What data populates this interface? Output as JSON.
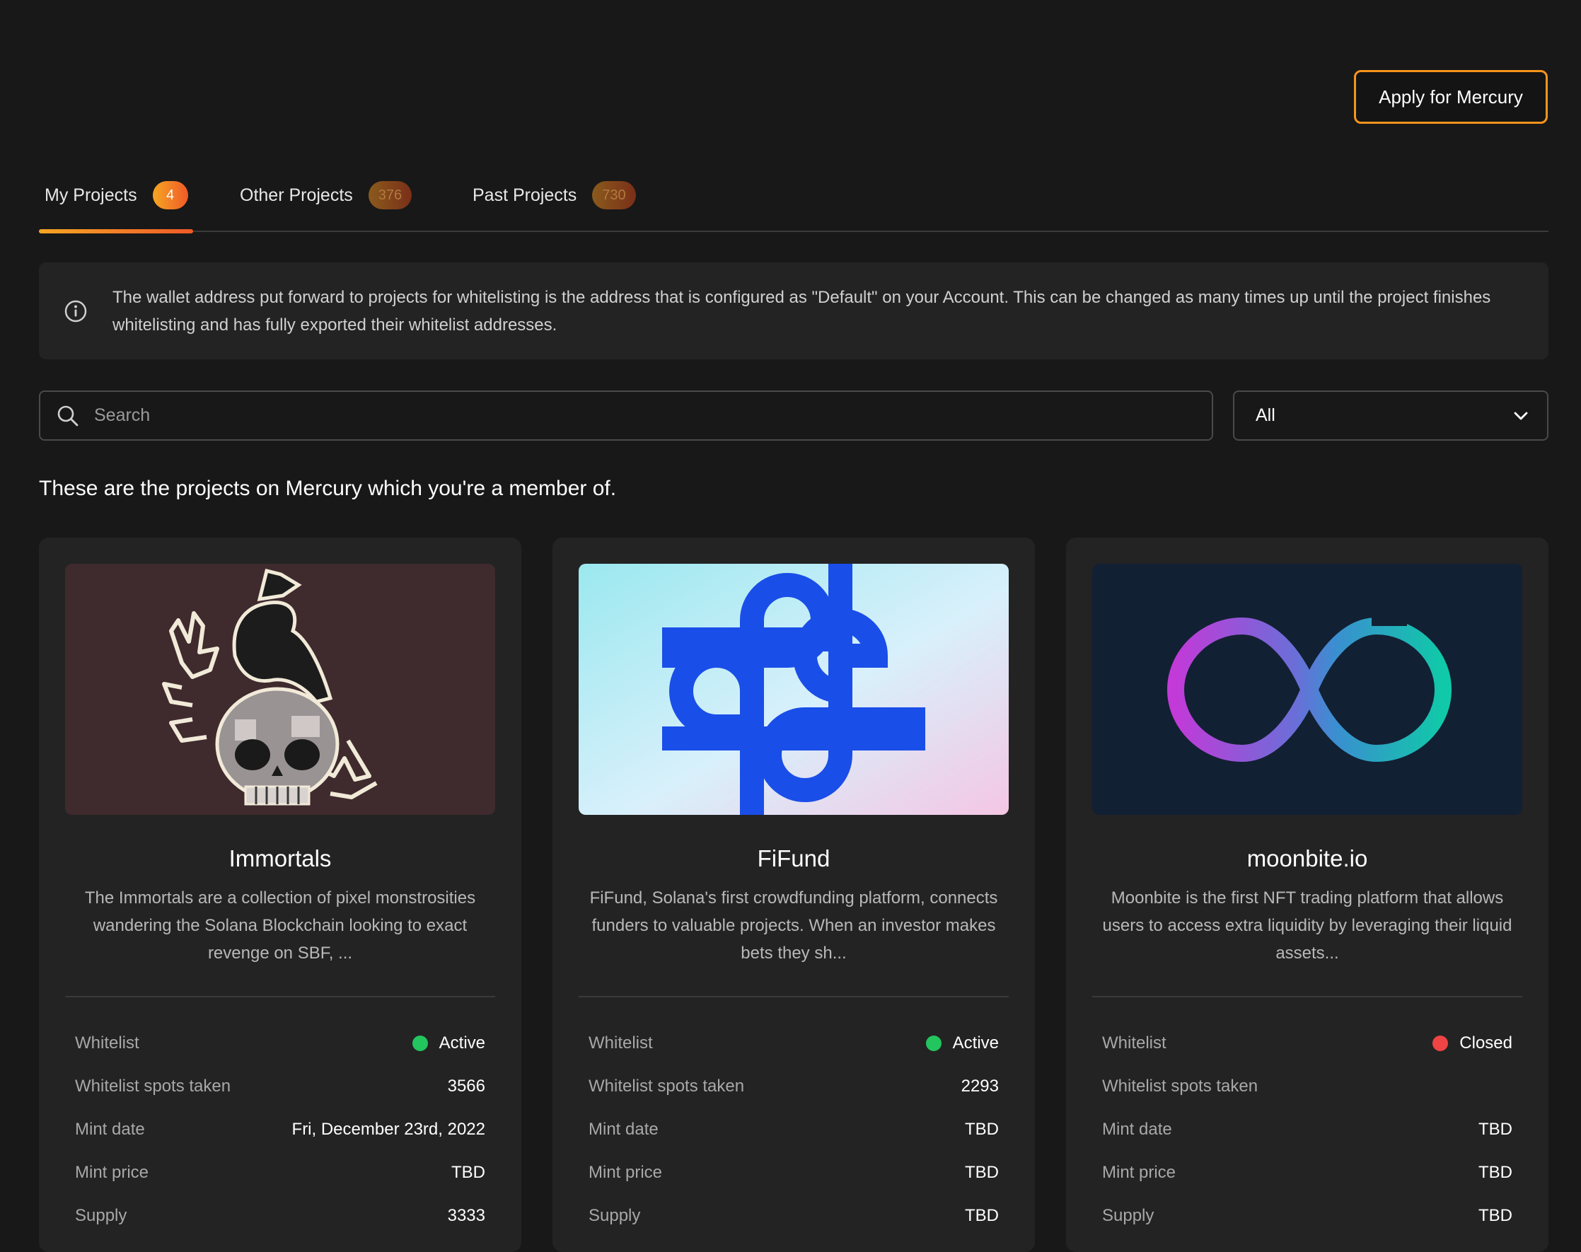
{
  "header": {
    "apply_label": "Apply for Mercury"
  },
  "tabs": [
    {
      "label": "My Projects",
      "count": "4",
      "active": true
    },
    {
      "label": "Other Projects",
      "count": "376",
      "active": false
    },
    {
      "label": "Past Projects",
      "count": "730",
      "active": false
    }
  ],
  "info": {
    "text": "The wallet address put forward to projects for whitelisting is the address that is configured as \"Default\" on your Account. This can be changed as many times up until the project finishes whitelisting and has fully exported their whitelist addresses."
  },
  "search": {
    "placeholder": "Search",
    "value": ""
  },
  "filter": {
    "selected": "All"
  },
  "subtitle": "These are the projects on Mercury which you're a member of.",
  "labels": {
    "whitelist": "Whitelist",
    "spots": "Whitelist spots taken",
    "mint_date": "Mint date",
    "mint_price": "Mint price",
    "supply": "Supply"
  },
  "colors": {
    "accent": "#f7941d",
    "active": "#22c55e",
    "closed": "#ef4444"
  },
  "projects": [
    {
      "name": "Immortals",
      "description": "The Immortals are a collection of pixel monstrosities wandering the Solana Blockchain looking to exact revenge on SBF, ...",
      "image": "pixel-skull-crow",
      "whitelist_status": "Active",
      "spots_taken": "3566",
      "mint_date": "Fri, December 23rd, 2022",
      "mint_price": "TBD",
      "supply": "3333"
    },
    {
      "name": "FiFund",
      "description": "FiFund, Solana's first crowdfunding platform, connects funders to valuable projects. When an investor makes bets they sh...",
      "image": "fifund-logo",
      "whitelist_status": "Active",
      "spots_taken": "2293",
      "mint_date": "TBD",
      "mint_price": "TBD",
      "supply": "TBD"
    },
    {
      "name": "moonbite.io",
      "description": "Moonbite is the first NFT trading platform that allows users to access extra liquidity by leveraging their liquid assets...",
      "image": "infinity-logo",
      "whitelist_status": "Closed",
      "spots_taken": "",
      "mint_date": "TBD",
      "mint_price": "TBD",
      "supply": "TBD"
    }
  ]
}
